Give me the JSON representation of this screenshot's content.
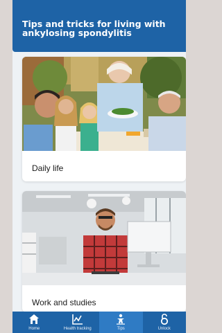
{
  "header": {
    "title": "Tips and tricks for living with ankylosing spondylitis"
  },
  "cards": [
    {
      "title": "Daily life",
      "image": "family-dinner-photo"
    },
    {
      "title": "Work and studies",
      "image": "office-worker-photo"
    }
  ],
  "nav": {
    "items": [
      {
        "label": "Home",
        "icon": "home-icon"
      },
      {
        "label": "Health tracking",
        "icon": "chart-icon"
      },
      {
        "label": "Tips",
        "icon": "person-icon"
      },
      {
        "label": "Unlock",
        "icon": "lock-icon"
      }
    ],
    "active": "Tips"
  },
  "colors": {
    "primary": "#1e63a6",
    "active_tab": "#2f7bc4",
    "background": "#eef2f5"
  }
}
